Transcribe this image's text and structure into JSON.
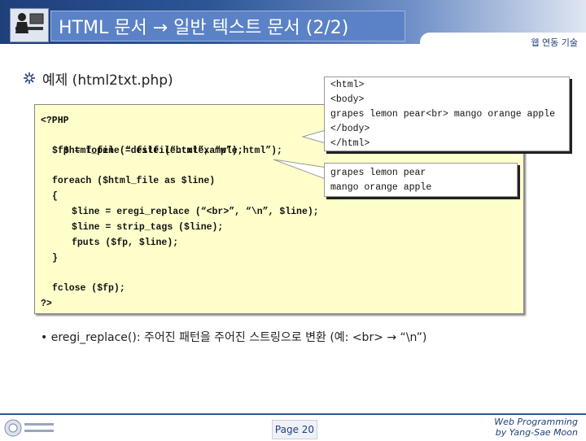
{
  "slide": {
    "title": "HTML 문서 → 일반 텍스트 문서 (2/2)",
    "subject": "웹 연동 기술",
    "example_heading": "예제 (html2txt.php)"
  },
  "code": {
    "line1": "<?PHP",
    "line2": "$html_file = file (“htmlexample.html”);",
    "line3": "$fp = fopen (“destfile.txt”, “w”);",
    "line4": "foreach ($html_file as $line)",
    "line5": "{",
    "line6": "$line = eregi_replace (“<br>”, “\\n”, $line);",
    "line7": "$line = strip_tags ($line);",
    "line8": "fputs ($fp, $line);",
    "line9": "}",
    "line10": "fclose ($fp);",
    "line11": "?>"
  },
  "callout_html": {
    "l1": "<html>",
    "l2": "<body>",
    "l3": "grapes lemon pear<br> mango orange apple",
    "l4": "</body>",
    "l5": "</html>"
  },
  "callout_text": {
    "l1": "grapes lemon pear",
    "l2": "mango orange apple"
  },
  "note": "eregi_replace(): 주어진 패턴을 주어진 스트링으로 변환 (예: <br> → “\\n”)",
  "footer": {
    "page": "Page 20",
    "credit_line1": "Web Programming",
    "credit_line2": "by Yang-Sae Moon"
  },
  "colors": {
    "accent": "#2c5597",
    "code_bg": "#ffffcc",
    "keyword": "#cc0000"
  },
  "icons": {
    "title_logo": "person-at-computer-icon",
    "bullet": "sparkle-bullet-icon",
    "footer_logo": "university-seal-icon"
  }
}
